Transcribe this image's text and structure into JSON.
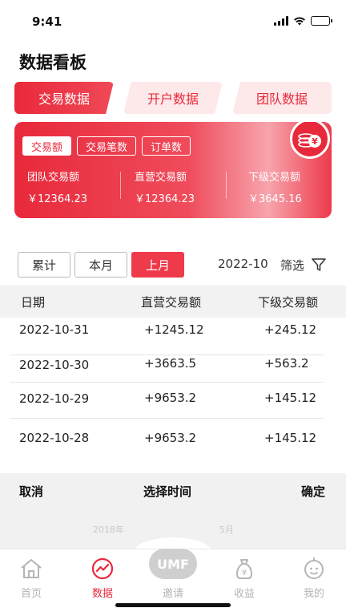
{
  "status_bar": {
    "time": "9:41"
  },
  "page": {
    "title": "数据看板"
  },
  "tabs": [
    {
      "label": "交易数据",
      "active": true
    },
    {
      "label": "开户数据",
      "active": false
    },
    {
      "label": "团队数据",
      "active": false
    }
  ],
  "summary": {
    "metric_tabs": [
      {
        "label": "交易额",
        "active": true
      },
      {
        "label": "交易笔数",
        "active": false
      },
      {
        "label": "订单数",
        "active": false
      }
    ],
    "columns": [
      {
        "label": "团队交易额",
        "value": "￥12364.23"
      },
      {
        "label": "直营交易额",
        "value": "￥12364.23"
      },
      {
        "label": "下级交易额",
        "value": "￥3645.16"
      }
    ],
    "icon": "coin-stack-icon"
  },
  "filters": {
    "periods": [
      {
        "label": "累计",
        "active": false
      },
      {
        "label": "本月",
        "active": false
      },
      {
        "label": "上月",
        "active": true
      }
    ],
    "month": "2022-10",
    "filter_label": "筛选"
  },
  "table": {
    "headers": [
      "日期",
      "直营交易额",
      "下级交易额"
    ],
    "rows": [
      [
        "2022-10-31",
        "+1245.12",
        "+245.12"
      ],
      [
        "2022-10-30",
        "+3663.5",
        "+563.2"
      ],
      [
        "2022-10-29",
        "+9653.2",
        "+145.12"
      ],
      [
        "2022-10-28",
        "+9653.2",
        "+145.12"
      ]
    ]
  },
  "picker": {
    "cancel": "取消",
    "title": "选择时间",
    "confirm": "确定",
    "year": "2018年",
    "month": "5月"
  },
  "bottom_nav": {
    "items": [
      {
        "label": "首页",
        "icon": "home-icon",
        "active": false
      },
      {
        "label": "数据",
        "icon": "chart-icon",
        "active": true
      },
      {
        "label": "邀请",
        "icon": "umf-badge",
        "active": false
      },
      {
        "label": "收益",
        "icon": "money-bag-icon",
        "active": false
      },
      {
        "label": "我的",
        "icon": "face-icon",
        "active": false
      }
    ],
    "badge_text": "UMF"
  },
  "colors": {
    "accent": "#e8293b",
    "accent_light": "#fde9ea",
    "inactive": "#b5b5b5"
  }
}
